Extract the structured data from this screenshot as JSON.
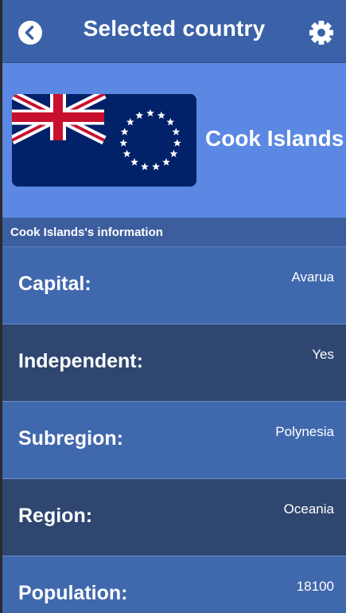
{
  "header": {
    "title": "Selected country",
    "back_icon": "back-arrow-icon",
    "settings_icon": "gear-icon"
  },
  "country": {
    "name": "Cook Islands",
    "flag": "cook-islands-flag"
  },
  "info": {
    "heading": "Cook Islands's information",
    "rows": [
      {
        "label": "Capital:",
        "value": "Avarua"
      },
      {
        "label": "Independent:",
        "value": "Yes"
      },
      {
        "label": "Subregion:",
        "value": "Polynesia"
      },
      {
        "label": "Region:",
        "value": "Oceania"
      },
      {
        "label": "Population:",
        "value": "18100"
      }
    ]
  },
  "colors": {
    "header": "#3b62a8",
    "hero": "#5b88e2",
    "row_light": "#4068ad",
    "row_dark": "#2e4670"
  }
}
